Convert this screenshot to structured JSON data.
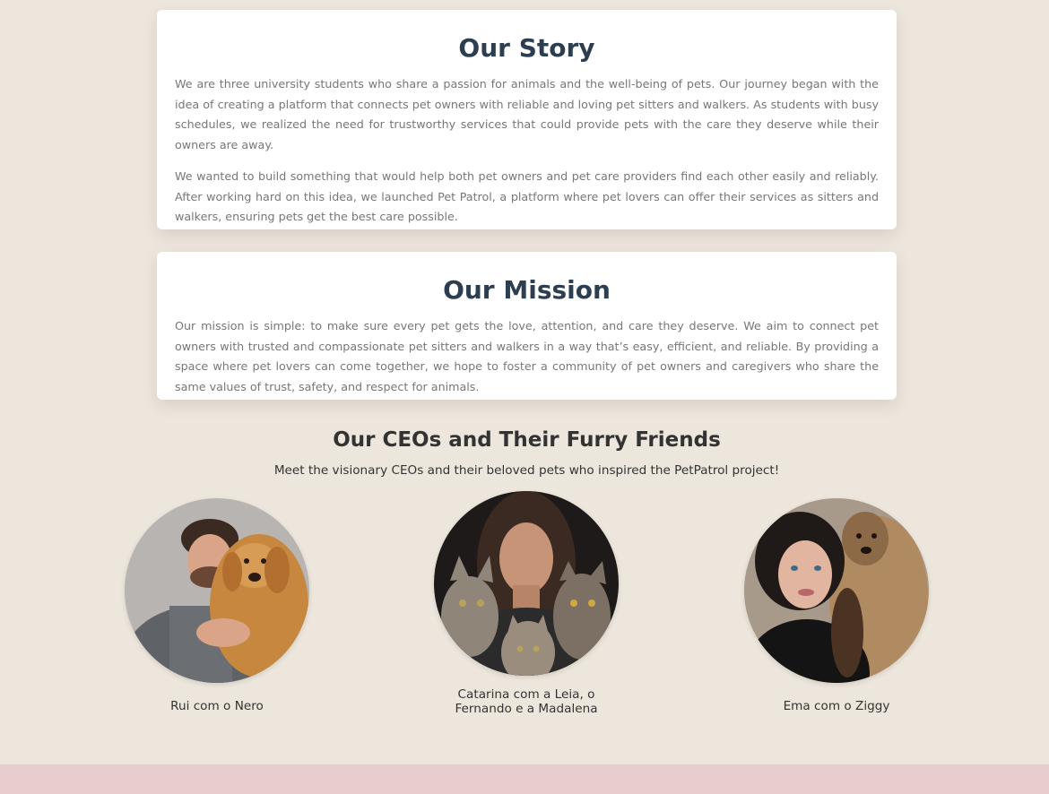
{
  "story": {
    "title": "Our Story",
    "paragraphs": [
      "We are three university students who share a passion for animals and the well-being of pets. Our journey began with the idea of creating a platform that connects pet owners with reliable and loving pet sitters and walkers. As students with busy schedules, we realized the need for trustworthy services that could provide pets with the care they deserve while their owners are away.",
      "We wanted to build something that would help both pet owners and pet care providers find each other easily and reliably. After working hard on this idea, we launched Pet Patrol, a platform where pet lovers can offer their services as sitters and walkers, ensuring pets get the best care possible."
    ]
  },
  "mission": {
    "title": "Our Mission",
    "paragraphs": [
      "Our mission is simple: to make sure every pet gets the love, attention, and care they deserve. We aim to connect pet owners with trusted and compassionate pet sitters and walkers in a way that’s easy, efficient, and reliable. By providing a space where pet lovers can come together, we hope to foster a community of pet owners and caregivers who share the same values of trust, safety, and respect for animals."
    ]
  },
  "ceos": {
    "title": "Our CEOs and Their Furry Friends",
    "subtitle": "Meet the visionary CEOs and their beloved pets who inspired the PetPatrol project!",
    "people": [
      {
        "caption": "Rui com o Nero"
      },
      {
        "caption": "Catarina com a Leia, o Fernando e a Madalena"
      },
      {
        "caption": "Ema com o Ziggy"
      }
    ]
  },
  "colors": {
    "page_background": "#ede6dc",
    "card_background": "#ffffff",
    "heading": "#2c3e50",
    "body_text": "#777777",
    "footer_band": "#e8cdcf"
  }
}
